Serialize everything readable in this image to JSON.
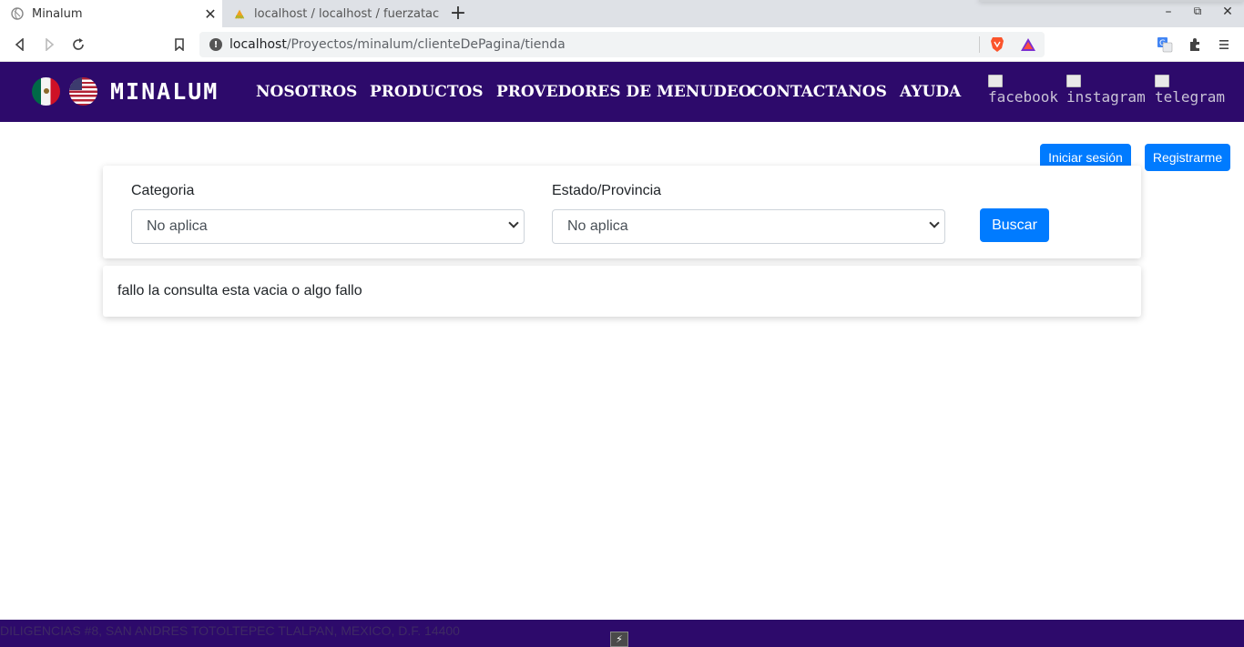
{
  "browser": {
    "tabs": [
      {
        "title": "Minalum",
        "active": true
      },
      {
        "title": "localhost / localhost / fuerzatac",
        "active": false
      }
    ],
    "url_host": "localhost",
    "url_path": "/Proyectos/minalum/clienteDePagina/tienda"
  },
  "site": {
    "brand": "MINALUM",
    "nav": [
      "NOSOTROS",
      "PRODUCTOS",
      "PROVEDORES DE MENUDEO",
      "CONTACTANOS",
      "AYUDA"
    ],
    "social": [
      "facebook",
      "instagram",
      "telegram"
    ],
    "colors": {
      "header_bg": "#2d0a6b",
      "primary": "#007bff"
    }
  },
  "auth": {
    "login": "Iniciar sesión",
    "register": "Registrarme"
  },
  "filters": {
    "category_label": "Categoria",
    "category_value": "No aplica",
    "state_label": "Estado/Provincia",
    "state_value": "No aplica",
    "search_label": "Buscar"
  },
  "result": {
    "message": "fallo la consulta esta vacia o algo fallo"
  },
  "footer": {
    "address": "DILIGENCIAS #8, SAN ANDRES TOTOLTEPEC TLALPAN, MEXICO, D.F. 14400"
  }
}
